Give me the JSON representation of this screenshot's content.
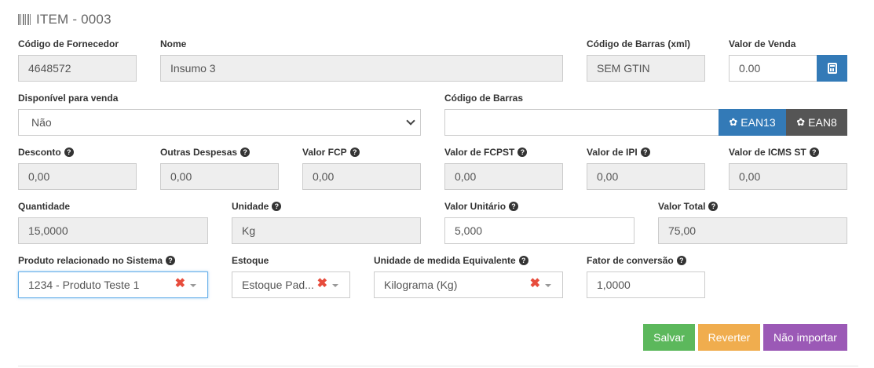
{
  "header": {
    "title": "ITEM - 0003",
    "icon": "barcode-icon"
  },
  "row1": {
    "codigo_fornecedor": {
      "label": "Código de Fornecedor",
      "value": "4648572"
    },
    "nome": {
      "label": "Nome",
      "value": "Insumo 3"
    },
    "codigo_barras_xml": {
      "label": "Código de Barras (xml)",
      "value": "SEM GTIN"
    },
    "valor_venda": {
      "label": "Valor de Venda",
      "value": "0.00",
      "icon": "calculator-icon"
    }
  },
  "row2": {
    "disponivel_venda": {
      "label": "Disponível para venda",
      "value": "Não"
    },
    "codigo_barras": {
      "label": "Código de Barras",
      "value": "",
      "ean13_label": "EAN13",
      "ean8_label": "EAN8"
    }
  },
  "row3": {
    "desconto": {
      "label": "Desconto",
      "value": "0,00"
    },
    "outras_despesas": {
      "label": "Outras Despesas",
      "value": "0,00"
    },
    "valor_fcp": {
      "label": "Valor FCP",
      "value": "0,00"
    },
    "valor_fcpst": {
      "label": "Valor de FCPST",
      "value": "0,00"
    },
    "valor_ipi": {
      "label": "Valor de IPI",
      "value": "0,00"
    },
    "valor_icms_st": {
      "label": "Valor de ICMS ST",
      "value": "0,00"
    }
  },
  "row4": {
    "quantidade": {
      "label": "Quantidade",
      "value": "15,0000"
    },
    "unidade": {
      "label": "Unidade",
      "value": "Kg"
    },
    "valor_unitario": {
      "label": "Valor Unitário",
      "value": "5,000"
    },
    "valor_total": {
      "label": "Valor Total",
      "value": "75,00"
    }
  },
  "row5": {
    "produto_relacionado": {
      "label": "Produto relacionado no Sistema",
      "value": "1234 - Produto Teste 1"
    },
    "estoque": {
      "label": "Estoque",
      "value": "Estoque Pad..."
    },
    "unidade_equivalente": {
      "label": "Unidade de medida Equivalente",
      "value": "Kilograma (Kg)"
    },
    "fator_conversao": {
      "label": "Fator de conversão",
      "value": "1,0000"
    }
  },
  "actions": {
    "salvar": "Salvar",
    "reverter": "Reverter",
    "nao_importar": "Não importar"
  },
  "colors": {
    "primary": "#337ab7",
    "dark": "#555555",
    "success": "#5cb85c",
    "warning": "#f0ad4e",
    "purple": "#9b59b6",
    "clear": "#e74c3c"
  }
}
